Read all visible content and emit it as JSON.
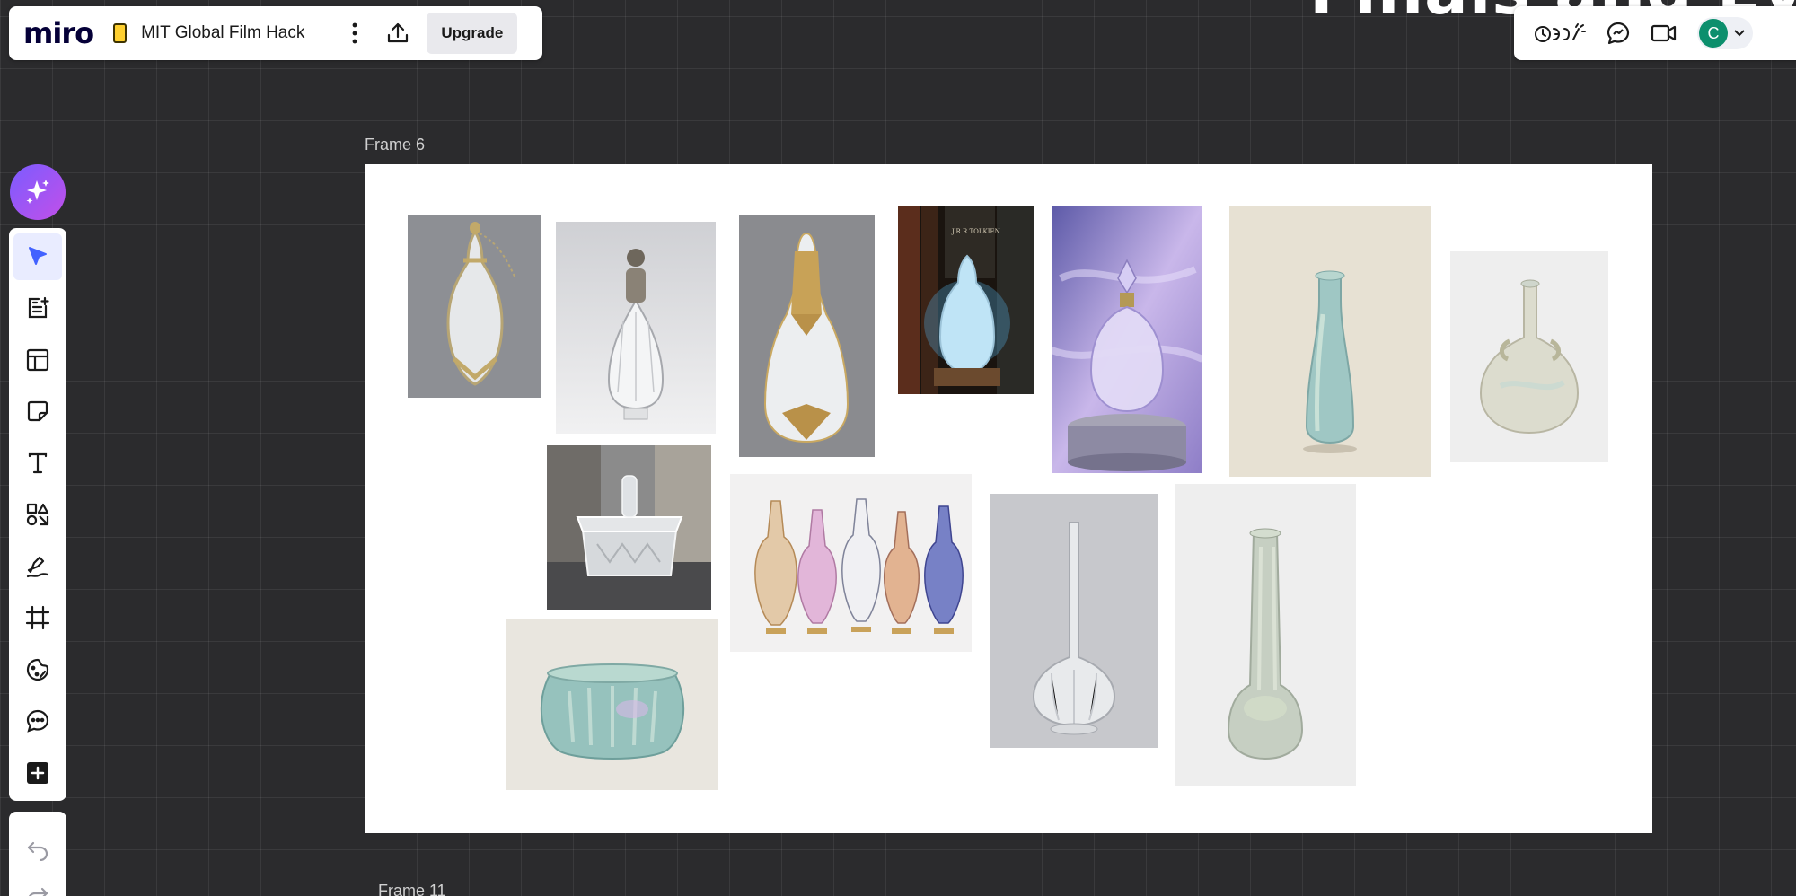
{
  "canvas_title": "Finals and Eval",
  "header": {
    "logo": "miro",
    "board_name": "MIT Global Film Hack",
    "upgrade_label": "Upgrade",
    "menu_icon": "more-vertical-icon",
    "share_icon": "upload-icon"
  },
  "right_bar": {
    "icons": [
      "reactions-icon",
      "chat-icon",
      "video-call-icon"
    ],
    "avatar_initial": "C"
  },
  "ai_button": {
    "icon": "sparkle-icon"
  },
  "toolbar": {
    "tools": [
      "select-tool",
      "templates-doc-tool",
      "layout-tool",
      "sticky-note-tool",
      "text-tool",
      "shapes-tool",
      "pen-tool",
      "frame-tool",
      "sticker-tool",
      "comment-tool",
      "add-apps-tool"
    ],
    "active": "select-tool"
  },
  "undo_bar": {
    "icons": [
      "undo-icon",
      "redo-icon"
    ]
  },
  "frames": {
    "main_label": "Frame 6",
    "next_label": "Frame 11"
  },
  "images": [
    "Crystal perfume bottle with silver filigree and chain",
    "Clear faceted bottle with silver cap",
    "Teardrop crystal bottle with gold lattice",
    "Glowing crystal bottle in front of Tolkien books",
    "Crystal perfume bottle in purple mist on pedestal",
    "Iridescent ancient glass flask",
    "Iridescent glass bottle with handles",
    "Cut glass lidded box",
    "Five Egyptian perfume bottles",
    "Iridescent ancient glass bowl",
    "Sprinkler bottle with long neck",
    "Iridescent long-neck glass bottle"
  ],
  "colors": {
    "canvas": "#2b2b2d",
    "accent": "#4262ff",
    "ai_gradient_start": "#7b5cff",
    "ai_gradient_end": "#c24fe9",
    "avatar": "#0c8f6d"
  }
}
